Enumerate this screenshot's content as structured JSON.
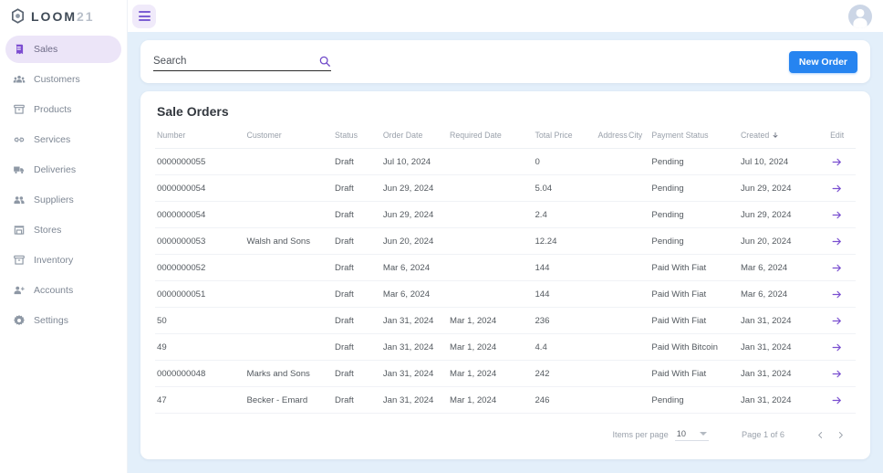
{
  "brand": {
    "name": "LOOM",
    "suffix": "21"
  },
  "sidebar": {
    "items": [
      {
        "label": "Sales",
        "icon": "sales-icon",
        "active": true
      },
      {
        "label": "Customers",
        "icon": "customers-icon",
        "active": false
      },
      {
        "label": "Products",
        "icon": "products-icon",
        "active": false
      },
      {
        "label": "Services",
        "icon": "services-icon",
        "active": false
      },
      {
        "label": "Deliveries",
        "icon": "deliveries-icon",
        "active": false
      },
      {
        "label": "Suppliers",
        "icon": "suppliers-icon",
        "active": false
      },
      {
        "label": "Stores",
        "icon": "stores-icon",
        "active": false
      },
      {
        "label": "Inventory",
        "icon": "inventory-icon",
        "active": false
      },
      {
        "label": "Accounts",
        "icon": "accounts-icon",
        "active": false
      },
      {
        "label": "Settings",
        "icon": "settings-icon",
        "active": false
      }
    ]
  },
  "topbar": {
    "menu_icon": "hamburger-icon",
    "avatar_icon": "user-avatar-icon"
  },
  "search": {
    "placeholder": "Search",
    "value": "",
    "icon": "search-icon"
  },
  "actions": {
    "new_order_label": "New Order",
    "new_order_color": "#2684f0"
  },
  "table": {
    "title": "Sale Orders",
    "sort_column": "Created",
    "sort_direction": "desc",
    "columns": [
      "Number",
      "Customer",
      "Status",
      "Order Date",
      "Required Date",
      "Total Price",
      "Address",
      "City",
      "Payment Status",
      "Created",
      "Edit"
    ],
    "rows": [
      {
        "number": "0000000055",
        "customer": "",
        "status": "Draft",
        "order_date": "Jul 10, 2024",
        "required_date": "",
        "total_price": "0",
        "address": "",
        "city": "",
        "payment_status": "Pending",
        "created": "Jul 10, 2024",
        "edit": "go-arrow-icon"
      },
      {
        "number": "0000000054",
        "customer": "",
        "status": "Draft",
        "order_date": "Jun 29, 2024",
        "required_date": "",
        "total_price": "5.04",
        "address": "",
        "city": "",
        "payment_status": "Pending",
        "created": "Jun 29, 2024",
        "edit": "go-arrow-icon"
      },
      {
        "number": "0000000054",
        "customer": "",
        "status": "Draft",
        "order_date": "Jun 29, 2024",
        "required_date": "",
        "total_price": "2.4",
        "address": "",
        "city": "",
        "payment_status": "Pending",
        "created": "Jun 29, 2024",
        "edit": "go-arrow-icon"
      },
      {
        "number": "0000000053",
        "customer": "Walsh and Sons",
        "status": "Draft",
        "order_date": "Jun 20, 2024",
        "required_date": "",
        "total_price": "12.24",
        "address": "",
        "city": "",
        "payment_status": "Pending",
        "created": "Jun 20, 2024",
        "edit": "go-arrow-icon"
      },
      {
        "number": "0000000052",
        "customer": "",
        "status": "Draft",
        "order_date": "Mar 6, 2024",
        "required_date": "",
        "total_price": "144",
        "address": "",
        "city": "",
        "payment_status": "Paid With Fiat",
        "created": "Mar 6, 2024",
        "edit": "go-arrow-icon"
      },
      {
        "number": "0000000051",
        "customer": "",
        "status": "Draft",
        "order_date": "Mar 6, 2024",
        "required_date": "",
        "total_price": "144",
        "address": "",
        "city": "",
        "payment_status": "Paid With Fiat",
        "created": "Mar 6, 2024",
        "edit": "go-arrow-icon"
      },
      {
        "number": "50",
        "customer": "",
        "status": "Draft",
        "order_date": "Jan 31, 2024",
        "required_date": "Mar 1, 2024",
        "total_price": "236",
        "address": "",
        "city": "",
        "payment_status": "Paid With Fiat",
        "created": "Jan 31, 2024",
        "edit": "go-arrow-icon"
      },
      {
        "number": "49",
        "customer": "",
        "status": "Draft",
        "order_date": "Jan 31, 2024",
        "required_date": "Mar 1, 2024",
        "total_price": "4.4",
        "address": "",
        "city": "",
        "payment_status": "Paid With Bitcoin",
        "created": "Jan 31, 2024",
        "edit": "go-arrow-icon"
      },
      {
        "number": "0000000048",
        "customer": "Marks and Sons",
        "status": "Draft",
        "order_date": "Jan 31, 2024",
        "required_date": "Mar 1, 2024",
        "total_price": "242",
        "address": "",
        "city": "",
        "payment_status": "Paid With Fiat",
        "created": "Jan 31, 2024",
        "edit": "go-arrow-icon"
      },
      {
        "number": "47",
        "customer": "Becker - Emard",
        "status": "Draft",
        "order_date": "Jan 31, 2024",
        "required_date": "Mar 1, 2024",
        "total_price": "246",
        "address": "",
        "city": "",
        "payment_status": "Pending",
        "created": "Jan 31, 2024",
        "edit": "go-arrow-icon"
      }
    ]
  },
  "pagination": {
    "items_per_page_label": "Items per page",
    "items_per_page_value": "10",
    "page_range": "Page 1 of 6",
    "prev_icon": "chevron-left-icon",
    "next_icon": "chevron-right-icon"
  }
}
